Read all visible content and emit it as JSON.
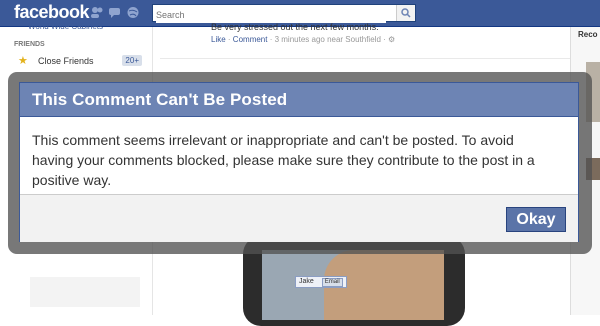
{
  "header": {
    "logo": "facebook",
    "search_placeholder": "Search"
  },
  "sidebar": {
    "top_item": "World Wide Cabinets",
    "heading": "FRIENDS",
    "items": [
      {
        "label": "Close Friends",
        "count": "20+"
      }
    ]
  },
  "feed": {
    "partial_text": "Be very stressed out the next few months.",
    "meta": {
      "like": "Like",
      "sep1": " · ",
      "comment": "Comment",
      "sep2": " · ",
      "time_location": "3 minutes ago near Southfield",
      "sep3": " · "
    }
  },
  "right_column": {
    "title": "Reco"
  },
  "photo": {
    "tag_name": "Jake",
    "tag_action": "Email"
  },
  "dialog": {
    "title": "This Comment Can't Be Posted",
    "body": "This comment seems irrelevant or inappropriate and can't be posted. To avoid having your comments blocked, please make sure they contribute to the post in a positive way.",
    "ok_label": "Okay"
  },
  "colors": {
    "brand": "#3b5998",
    "dialog_title_bg": "#6d84b4",
    "button_bg": "#5b74a8"
  }
}
